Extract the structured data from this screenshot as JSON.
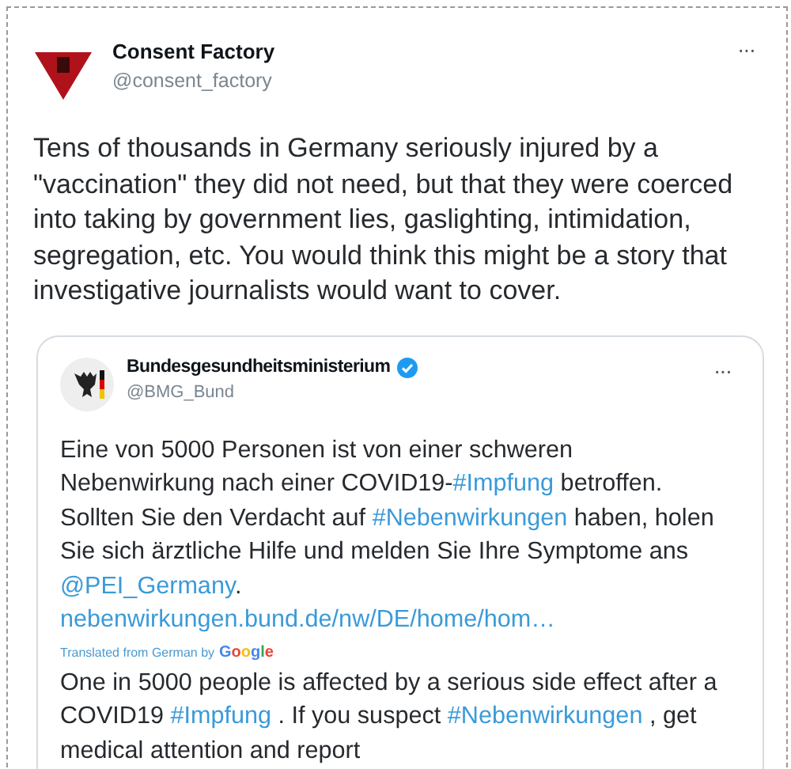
{
  "tweet": {
    "author": {
      "name": "Consent Factory",
      "handle": "@consent_factory"
    },
    "more": "···",
    "text": "Tens of thousands in Germany seriously injured by a \"vaccination\" they did not need, but that they were coerced into taking by government lies, gaslighting, intimidation, segregation, etc. You would think this might be a story that investigative journalists would want to cover.",
    "quoted": {
      "author": {
        "name": "Bundesgesundheitsministerium",
        "handle": "@BMG_Bund",
        "verified": true
      },
      "more": "···",
      "original": [
        {
          "kind": "text",
          "text": "Eine von 5000 Personen ist von einer schweren Nebenwirkung nach einer COVID19-"
        },
        {
          "kind": "link",
          "text": "#Impfung"
        },
        {
          "kind": "text",
          "text": " betroffen. Sollten Sie den Verdacht auf "
        },
        {
          "kind": "link",
          "text": "#Nebenwirkungen"
        },
        {
          "kind": "text",
          "text": " haben, holen Sie sich ärztliche Hilfe und melden Sie Ihre Symptome ans "
        },
        {
          "kind": "link",
          "text": "@PEI_Germany"
        },
        {
          "kind": "text",
          "text": ". "
        },
        {
          "kind": "link",
          "text": "nebenwirkungen.bund.de/nw/DE/home/hom…"
        }
      ],
      "translation_note": "Translated from German by",
      "translator": "Google",
      "translated": [
        {
          "kind": "text",
          "text": "One in 5000 people is affected by a serious side effect after a COVID19 "
        },
        {
          "kind": "link",
          "text": "#Impfung"
        },
        {
          "kind": "text",
          "text": " . If you suspect "
        },
        {
          "kind": "link",
          "text": "#Nebenwirkungen"
        },
        {
          "kind": "text",
          "text": " , get medical attention and report"
        }
      ]
    }
  }
}
